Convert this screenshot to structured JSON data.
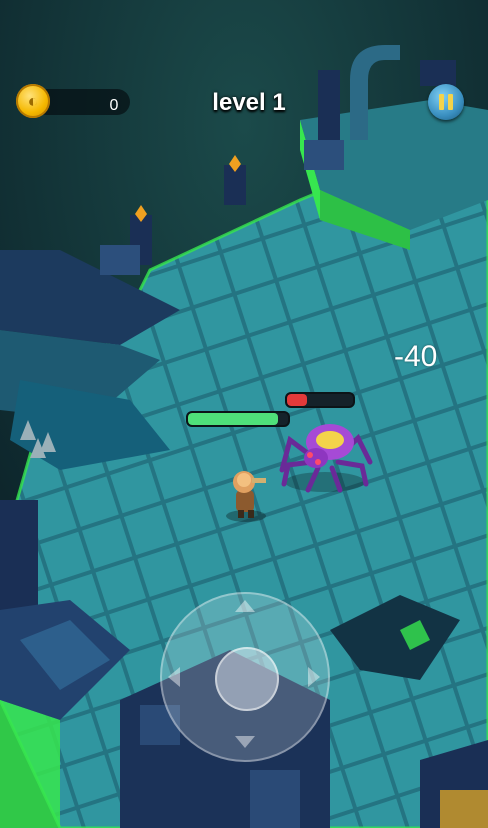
{
  "hud": {
    "coin_count": "0",
    "coin_icon": "gold-coin-icon",
    "level_label": "level 1",
    "pause_icon": "pause-icon"
  },
  "combat": {
    "damage_popup": "-40",
    "player_health_fraction": 0.9,
    "enemy_health_fraction": 0.3,
    "player_health_color": "#4fe07a",
    "enemy_health_color": "#e23a3a"
  },
  "controls": {
    "joystick": "virtual-joystick",
    "joystick_arrows": [
      "up",
      "down",
      "left",
      "right"
    ]
  },
  "colors": {
    "floor_teal": "#2f8c96",
    "glow_green": "#37e64f",
    "wall_blue": "#1f3f6e",
    "coin_gold": "#f5b800",
    "spider_purple": "#9b3fd0"
  }
}
